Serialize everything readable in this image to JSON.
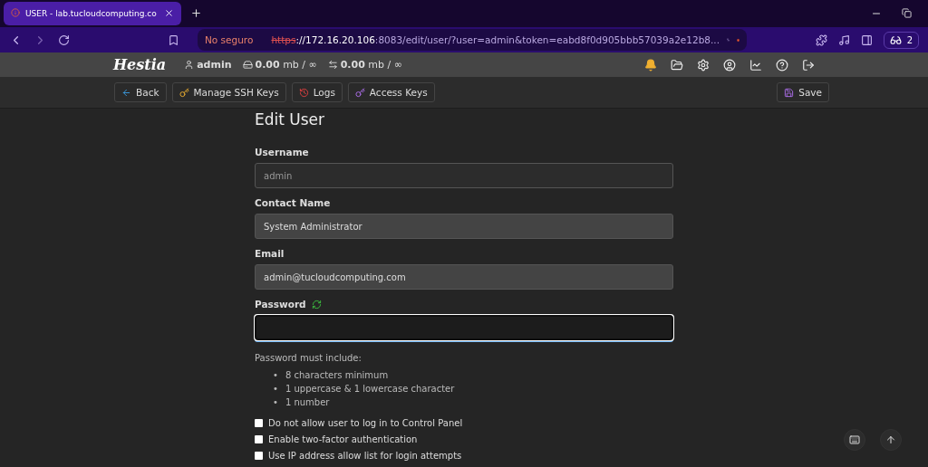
{
  "browser": {
    "tab": {
      "title": "USER - lab.tucloudcomputing.co",
      "selected": true
    },
    "security": "No seguro",
    "url": {
      "scheme": "https",
      "host": "://172.16.20.106",
      "path": ":8083/edit/user/?user=admin&token=eabd8f0d905bbb57039a2e12b8..."
    },
    "shield_count": "2"
  },
  "header": {
    "logo": "Hestia",
    "user": "admin",
    "disk": {
      "value": "0.00",
      "unit": "mb / ∞"
    },
    "bandwidth": {
      "value": "0.00",
      "unit": "mb / ∞"
    }
  },
  "toolbar": {
    "buttons": [
      {
        "kind": "back",
        "label": "Back"
      },
      {
        "kind": "ssh",
        "label": "Manage SSH Keys"
      },
      {
        "kind": "logs",
        "label": "Logs"
      },
      {
        "kind": "access",
        "label": "Access Keys"
      }
    ],
    "save": "Save"
  },
  "form": {
    "title": "Edit User",
    "fields": [
      {
        "label": "Username",
        "value": "admin",
        "disabled": true,
        "focused": false
      },
      {
        "label": "Contact Name",
        "value": "System Administrator",
        "disabled": false,
        "focused": false
      },
      {
        "label": "Email",
        "value": "admin@tucloudcomputing.com",
        "disabled": false,
        "focused": false
      },
      {
        "label": "Password",
        "disabled": false,
        "focused": true,
        "generate": true
      }
    ],
    "hint": "Password must include:",
    "rules": [
      {
        "marker": "•",
        "text": "8 characters minimum"
      },
      {
        "marker": "•",
        "text": "1 uppercase & 1 lowercase character"
      },
      {
        "marker": "•",
        "text": "1 number"
      }
    ],
    "options": [
      {
        "label": "Do not allow user to log in to Control Panel",
        "checked": false
      },
      {
        "label": "Enable two-factor authentication",
        "checked": false
      },
      {
        "label": "Use IP address allow list for login attempts",
        "checked": false
      }
    ]
  }
}
